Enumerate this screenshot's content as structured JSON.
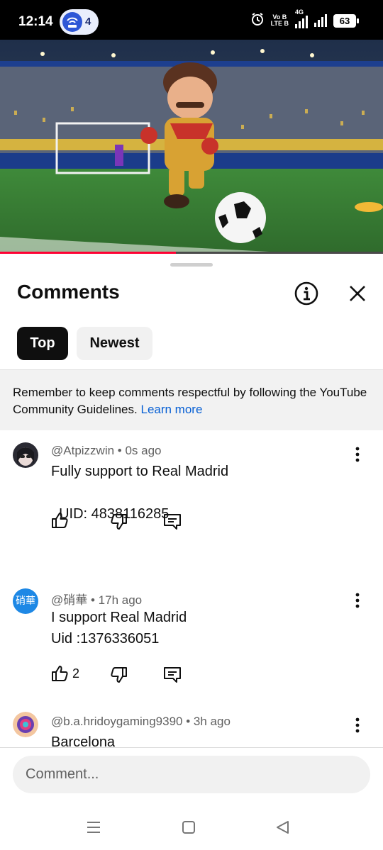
{
  "status_bar": {
    "time": "12:14",
    "hotspot_count": "4",
    "volte_top": "Vo B",
    "volte_bottom": "LTE B",
    "network": "4G",
    "battery": "63",
    "icons": [
      "hotspot-icon",
      "alarm-icon",
      "signal-icon",
      "battery-icon"
    ]
  },
  "video": {
    "progress_fraction": 0.46,
    "description_hidden": true
  },
  "panel": {
    "title": "Comments",
    "info_icon": "info-icon",
    "close_icon": "close-icon"
  },
  "tabs": [
    {
      "label": "Top",
      "selected": true
    },
    {
      "label": "Newest",
      "selected": false
    }
  ],
  "notice": {
    "text": "Remember to keep comments respectful by following the YouTube Community Guidelines.",
    "link": "Learn more"
  },
  "comments": [
    {
      "author": "@Atpizzwin",
      "time": "0s ago",
      "text": "Fully support to Real Madrid\n\n  UID: 4838116285",
      "likes": ""
    },
    {
      "author": "@硝華",
      "time": "17h ago",
      "text": "I support Real Madrid\nUid :1376336051",
      "likes": "2",
      "avatar_text": "硝華"
    },
    {
      "author": "@b.a.hridoygaming9390",
      "time": "3h ago",
      "text": "Barcelona",
      "likes": ""
    }
  ],
  "comment_box": {
    "placeholder": "Comment..."
  },
  "colors": {
    "accent_red": "#ff0033",
    "link_blue": "#065fd4",
    "chip_dark": "#0f0f0f"
  }
}
